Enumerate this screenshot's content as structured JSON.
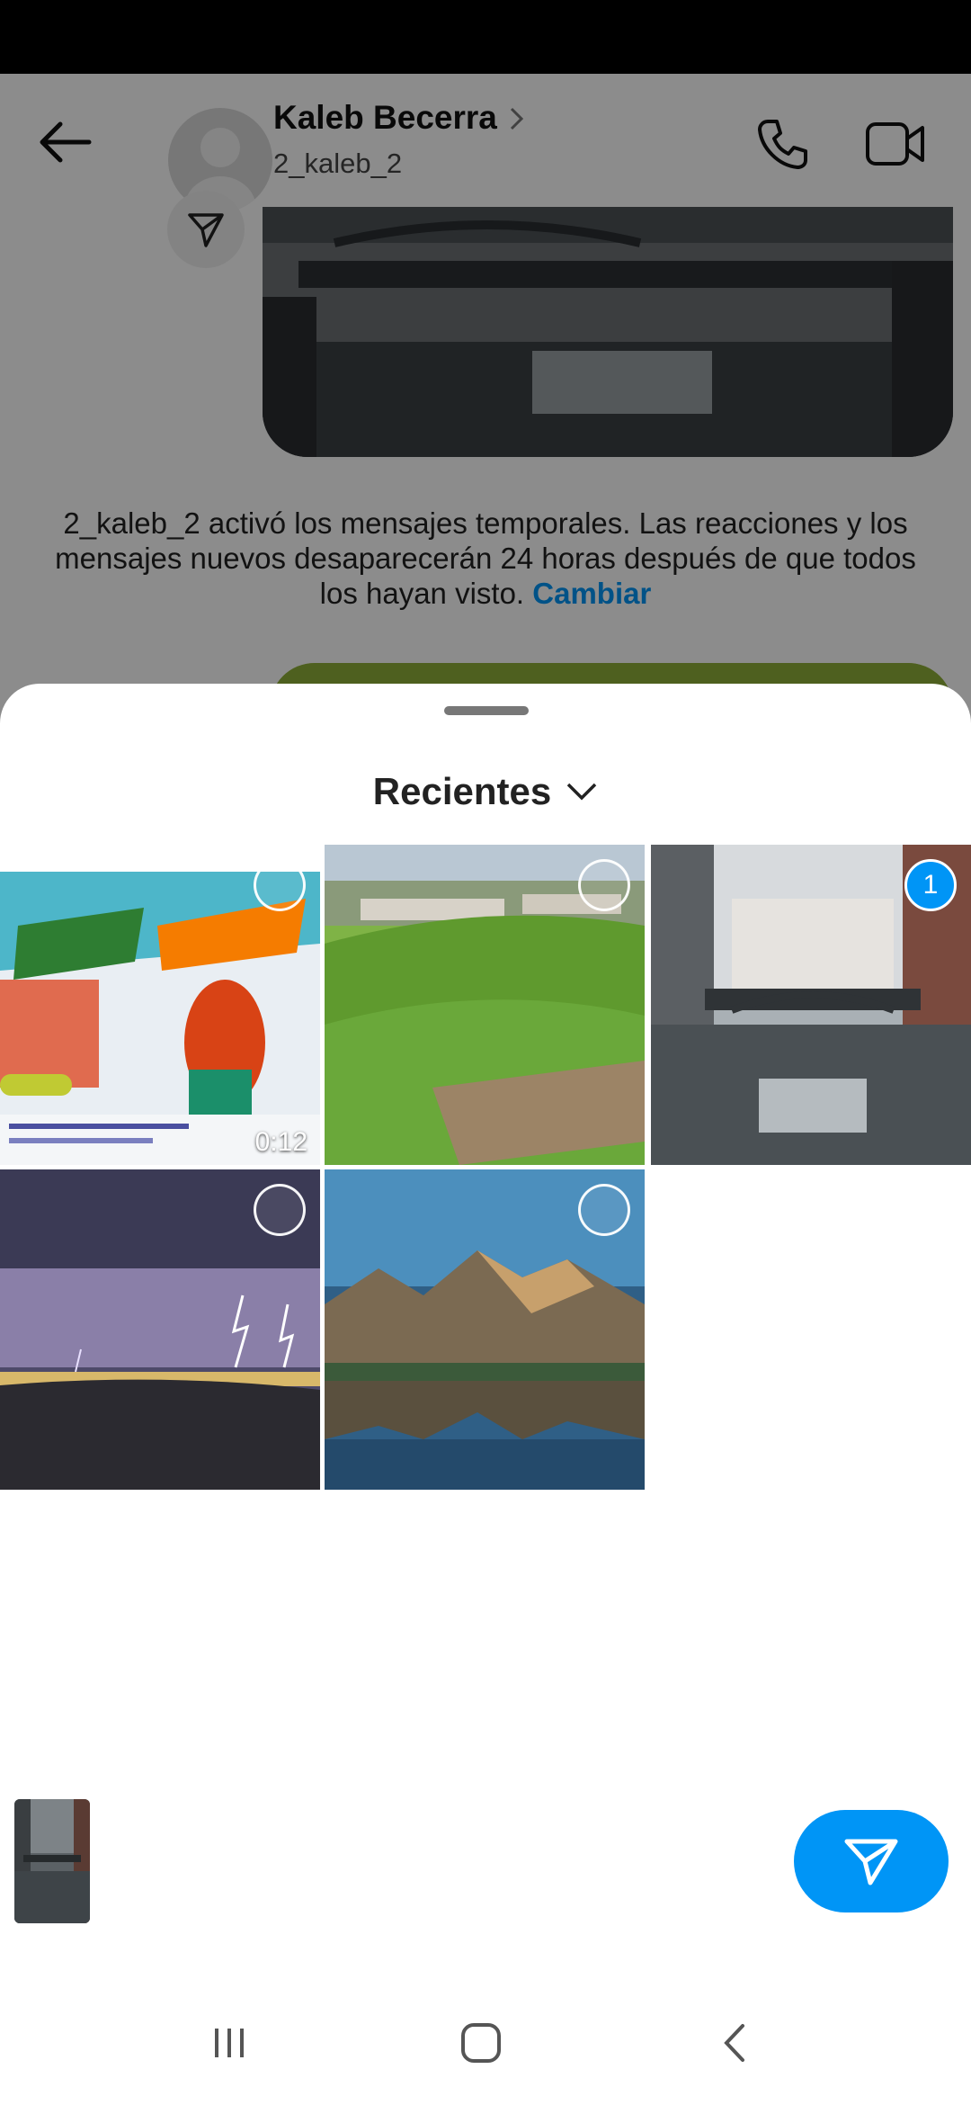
{
  "chat": {
    "contact_name": "Kaleb Becerra",
    "contact_username": "2_kaleb_2",
    "notice_text": "2_kaleb_2 activó los mensajes temporales. Las reacciones y los mensajes nuevos desaparecerán 24 horas después de que todos los hayan visto.",
    "notice_link": "Cambiar"
  },
  "sheet": {
    "album_title": "Recientes",
    "media": [
      {
        "kind": "video",
        "duration": "0:12",
        "selected": false
      },
      {
        "kind": "photo",
        "selected": false
      },
      {
        "kind": "photo",
        "selected": true,
        "selection_index": "1"
      },
      {
        "kind": "photo",
        "selected": false
      },
      {
        "kind": "photo",
        "selected": false
      }
    ]
  },
  "colors": {
    "accent": "#0095f6",
    "overlay": "rgba(0,0,0,0.45)",
    "sheet": "#ffffff"
  },
  "icons": [
    "back-arrow-icon",
    "chevron-right-icon",
    "phone-icon",
    "video-camera-icon",
    "paper-plane-icon",
    "chevron-down-icon",
    "send-icon",
    "recents-icon",
    "home-icon",
    "nav-back-icon"
  ]
}
